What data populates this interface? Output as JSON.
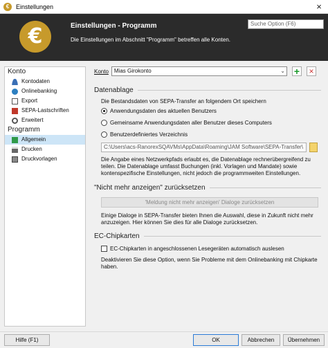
{
  "window": {
    "title": "Einstellungen",
    "app_icon": "€",
    "close_icon": "×"
  },
  "header": {
    "title": "Einstellungen - Programm",
    "subtitle": "Die Einstellungen im Abschnitt \"Programm\" betreffen alle Konten.",
    "coin": "€",
    "search_placeholder": "Suche Option (F6)"
  },
  "sidebar": {
    "group_konto": "Konto",
    "konto_items": [
      {
        "label": "Kontodaten",
        "icon": "user-icon"
      },
      {
        "label": "Onlinebanking",
        "icon": "globe-icon"
      },
      {
        "label": "Export",
        "icon": "document-icon"
      },
      {
        "label": "SEPA-Lastschriften",
        "icon": "sepa-icon"
      },
      {
        "label": "Erweitert",
        "icon": "magnifier-icon"
      }
    ],
    "group_programm": "Programm",
    "programm_items": [
      {
        "label": "Allgemein",
        "icon": "check-icon"
      },
      {
        "label": "Drucken",
        "icon": "printer-icon"
      },
      {
        "label": "Druckvorlagen",
        "icon": "template-icon"
      }
    ]
  },
  "content": {
    "konto_label": "Konto",
    "konto_value": "Mias Girokonto",
    "chevron": "⌄",
    "add": "+",
    "delete": "×",
    "datenablage": {
      "heading": "Datenablage",
      "intro": "Die Bestandsdaten von SEPA-Transfer an folgendem Ort speichern",
      "options": [
        "Anwendungsdaten des aktuellen Benutzers",
        "Gemeinsame Anwendungsdaten aller Benutzer dieses Computers",
        "Benutzerdefiniertes Verzeichnis"
      ],
      "path": "C:\\Users\\acs-RanorexSQAVMs\\AppData\\Roaming\\JAM Software\\SEPA-Transfer\\",
      "note": "Die Angabe eines Netzwerkpfads erlaubt es, die Datenablage rechnerübergreifend zu teilen. Die Datenablage umfasst Buchungen (inkl. Vorlagen und Mandate) sowie kontenspezifische Einstellungen, nicht jedoch die programmweiten Einstellungen."
    },
    "nicht_mehr": {
      "heading": "\"Nicht mehr anzeigen\" zurücksetzen",
      "button": "'Meldung nicht mehr anzeigen' Dialoge zurücksetzen",
      "note": "Einige Dialoge in SEPA-Transfer bieten Ihnen die Auswahl, diese in Zukunft nicht mehr anzuzeigen. Hier können Sie dies für alle Dialoge zurücksetzen."
    },
    "chipkarten": {
      "heading": "EC-Chipkarten",
      "checkbox": "EC-Chipkarten in angeschlossenen Lesegeräten automatisch auslesen",
      "note": "Deaktivieren Sie diese Option, wenn Sie Probleme mit dem Onlinebanking mit Chipkarte haben."
    }
  },
  "footer": {
    "help": "Hilfe (F1)",
    "ok": "OK",
    "cancel": "Abbrechen",
    "apply": "Übernehmen"
  }
}
